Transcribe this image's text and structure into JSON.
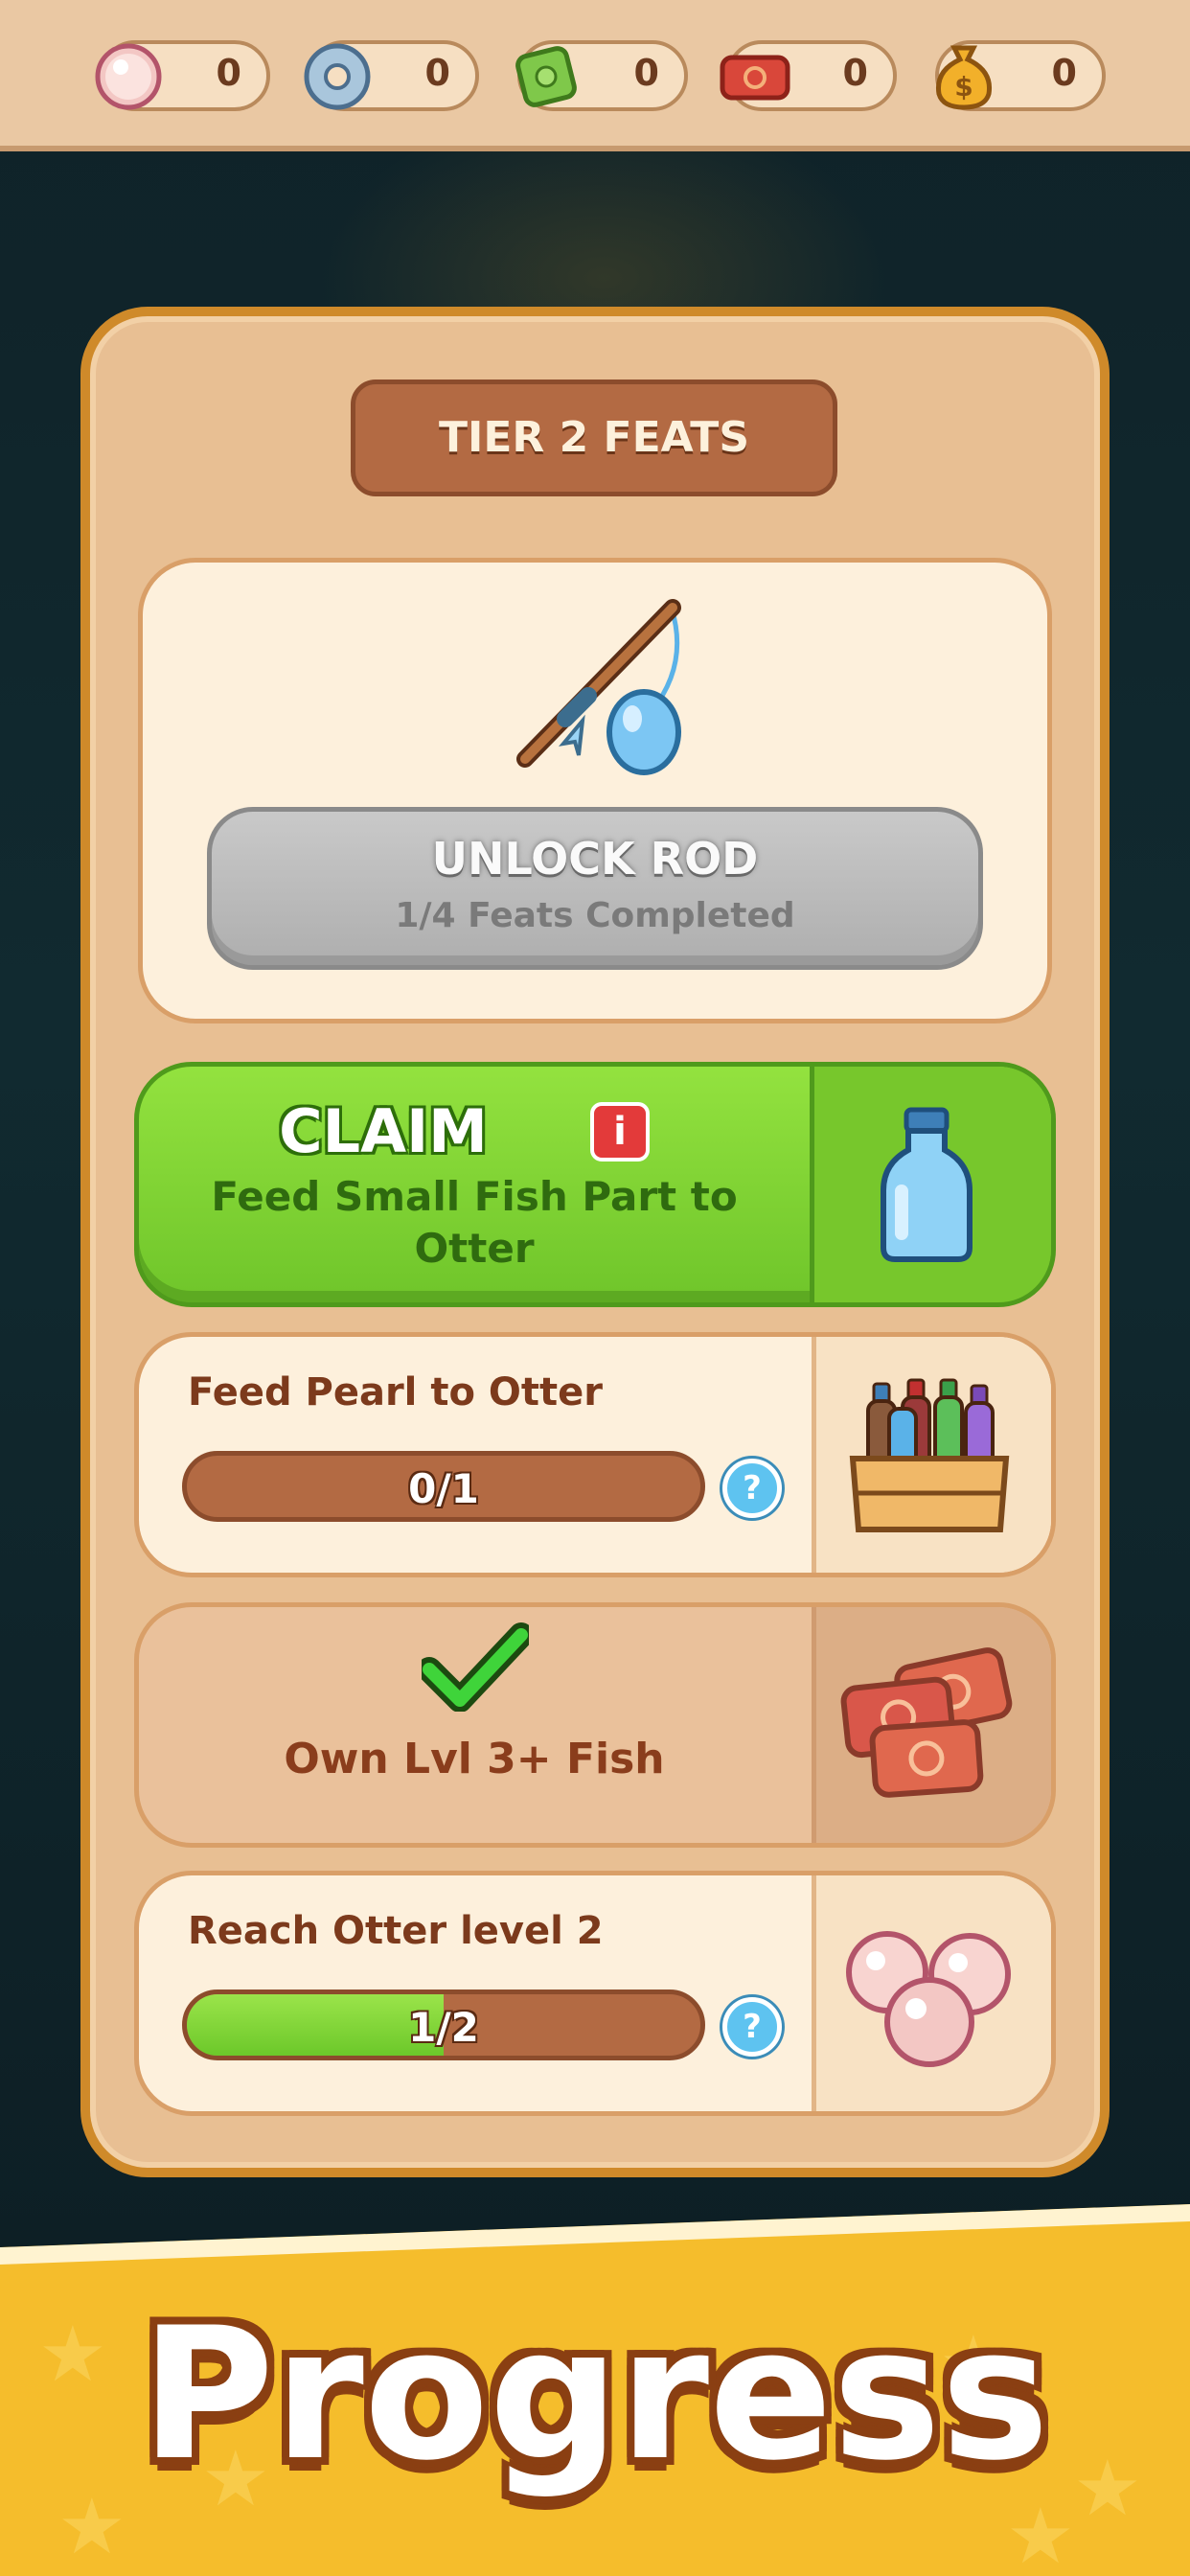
{
  "currencies": [
    {
      "name": "pearl",
      "icon": "pearl-icon",
      "value": "0"
    },
    {
      "name": "ring",
      "icon": "ring-icon",
      "value": "0"
    },
    {
      "name": "gem",
      "icon": "green-gem-icon",
      "value": "0"
    },
    {
      "name": "ticket",
      "icon": "ticket-icon",
      "value": "0"
    },
    {
      "name": "money",
      "icon": "money-bag-icon",
      "value": "0"
    }
  ],
  "panel": {
    "title": "TIER 2 FEATS",
    "reward": {
      "icon": "fishing-rod-icon",
      "button_label": "UNLOCK ROD",
      "button_sub": "1/4 Feats Completed"
    },
    "claim": {
      "label": "CLAIM",
      "info_icon": "info-icon",
      "info_glyph": "i",
      "description": "Feed Small Fish Part to Otter",
      "reward_icon": "water-bottle-icon"
    },
    "feats": [
      {
        "title": "Feed Pearl to Otter",
        "progress": "0/1",
        "fraction": 0,
        "help": "?",
        "reward_icon": "bottle-crate-icon"
      },
      {
        "title": "Own Lvl 3+ Fish",
        "completed": true,
        "check_icon": "checkmark-icon",
        "reward_icon": "tickets-icon"
      },
      {
        "title": "Reach Otter level 2",
        "progress": "1/2",
        "fraction": 0.5,
        "help": "?",
        "reward_icon": "pearls-icon"
      }
    ]
  },
  "footer": {
    "title": "Progress"
  },
  "colors": {
    "panel_border": "#cf8a2a",
    "claim_green": "#7fd232",
    "progress_brown": "#b36a43",
    "footer_yellow": "#f5bd2c"
  }
}
